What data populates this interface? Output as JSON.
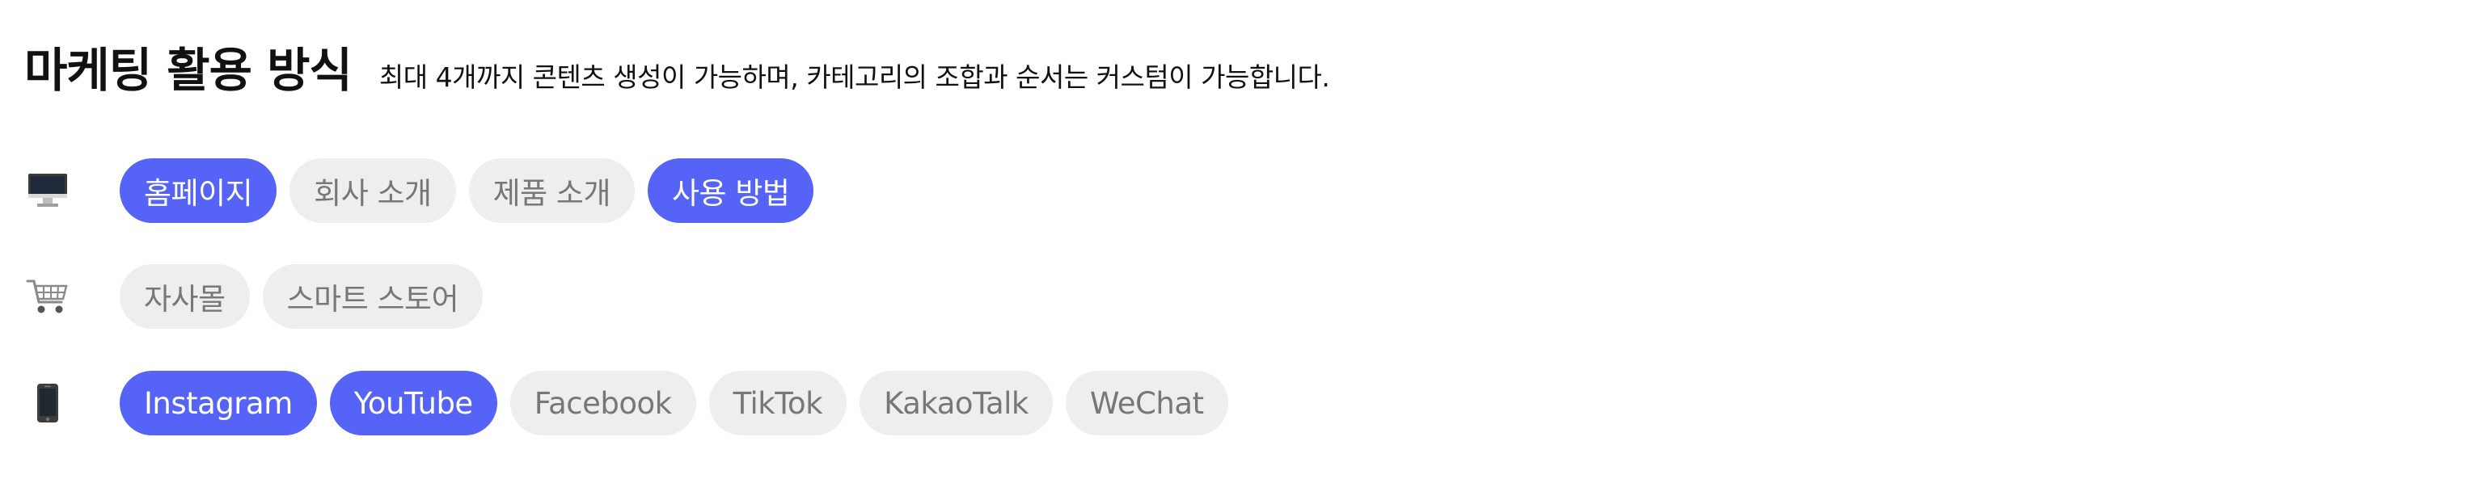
{
  "header": {
    "title": "마케팅 활용 방식",
    "subtitle": "최대 4개까지 콘텐츠 생성이 가능하며, 카테고리의 조합과 순서는 커스텀이 가능합니다."
  },
  "colors": {
    "selected": "#5563F7",
    "unselected_bg": "#EEEEEE",
    "unselected_text": "#777777"
  },
  "rows": [
    {
      "icon": "desktop-computer-icon",
      "chips": [
        {
          "label": "홈페이지",
          "selected": true
        },
        {
          "label": "회사 소개",
          "selected": false
        },
        {
          "label": "제품 소개",
          "selected": false
        },
        {
          "label": "사용 방법",
          "selected": true
        }
      ]
    },
    {
      "icon": "shopping-cart-icon",
      "chips": [
        {
          "label": "자사몰",
          "selected": false
        },
        {
          "label": "스마트 스토어",
          "selected": false
        }
      ]
    },
    {
      "icon": "mobile-phone-icon",
      "chips": [
        {
          "label": "Instagram",
          "selected": true
        },
        {
          "label": "YouTube",
          "selected": true
        },
        {
          "label": "Facebook",
          "selected": false
        },
        {
          "label": "TikTok",
          "selected": false
        },
        {
          "label": "KakaoTalk",
          "selected": false
        },
        {
          "label": "WeChat",
          "selected": false
        }
      ]
    }
  ]
}
